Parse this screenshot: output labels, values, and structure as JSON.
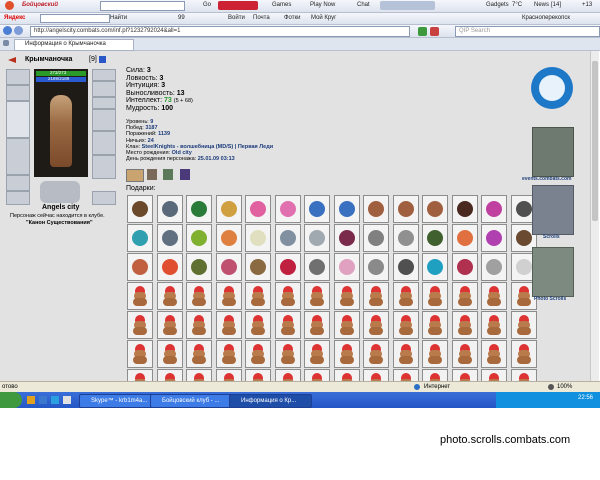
{
  "toolbar1": {
    "logo_text": "Бойцовский",
    "search_placeholder": "",
    "go_label": "Go",
    "games_label": "Games",
    "play_now_label": "Play Now",
    "chat_label": "Chat",
    "gadgets_label": "Gadgets",
    "temperature": "7°C",
    "news_label": "News",
    "news_count": "[14]",
    "news_plus": "+13"
  },
  "toolbar2": {
    "yandex_label": "Яндекс",
    "find_label": "Найти",
    "count_label": "99",
    "login_label": "Войти",
    "mail_label": "Почта",
    "photos_label": "Фотки",
    "moy_krug_label": "Мой Круг",
    "city_label": "Красноперекопск"
  },
  "address": {
    "url": "http://angelscity.combats.com/inf.pl?1232792024&all=1",
    "search_placeholder": "QIP Search"
  },
  "tab": {
    "title": "Информация о Крымчаночка"
  },
  "character": {
    "name": "Крымчаночка",
    "level": "[9]",
    "hp": "273/273",
    "mana": "2189/2189",
    "club_name": "Angels city",
    "location_line1": "Персонаж сейчас находится в клубе.",
    "location_line2": "\"Канон Существования\""
  },
  "stats": [
    {
      "label": "Сила:",
      "value": "3"
    },
    {
      "label": "Ловкость:",
      "value": "3"
    },
    {
      "label": "Интуиция:",
      "value": "3"
    },
    {
      "label": "Выносливость:",
      "value": "13"
    },
    {
      "label": "Интеллект:",
      "value": "73",
      "extra": "(5 + 68)"
    },
    {
      "label": "Мудрость:",
      "value": "100"
    }
  ],
  "details": [
    {
      "label": "Уровень:",
      "value": "9"
    },
    {
      "label": "Побед:",
      "value": "3187"
    },
    {
      "label": "Поражений:",
      "value": "1139"
    },
    {
      "label": "Ничьих:",
      "value": "24"
    },
    {
      "label": "Клан:",
      "value": "SteelKnights - волшебница (MD/S) | Первая Леди"
    },
    {
      "label": "Место рождения:",
      "value": "Old city"
    },
    {
      "label": "День рождения персонажа:",
      "value": "25.01.09 03:13"
    }
  ],
  "gifts_label": "Подарки:",
  "sidebar": {
    "events_label": "events.combats.com",
    "scrolls_label": "Scrolls",
    "photo_scrolls_label": "Photo Scrolls"
  },
  "statusbar": {
    "left_text": "отово",
    "zone_text": "Интернет",
    "zoom_text": "100%"
  },
  "taskbar": {
    "tasks": [
      "Skype™ - krb1m4a...",
      "Бойцовский клуб - ...",
      "Информация о Кр..."
    ],
    "clock": "22:56"
  },
  "watermark": "photo.scrolls.combats.com",
  "colors": {
    "content_bg": "#e2e2e2",
    "accent_blue": "#1e78c8",
    "taskbar_blue": "#2456c5",
    "hp_green": "#2a9a2a"
  }
}
